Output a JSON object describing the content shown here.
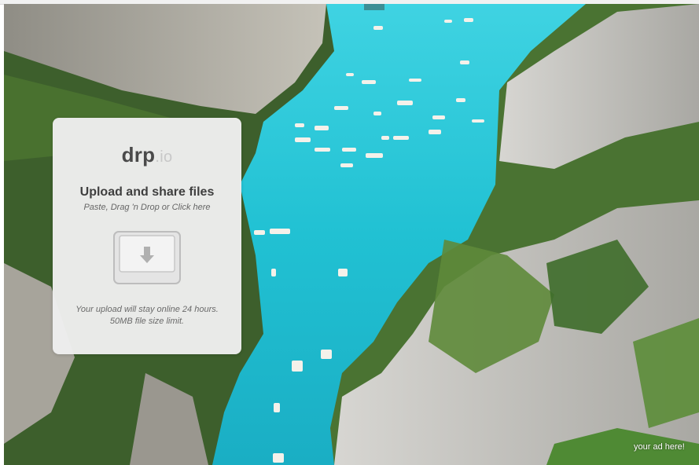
{
  "brand": {
    "name": "drp",
    "tld": ".io"
  },
  "card": {
    "title": "Upload and share files",
    "subtitle": "Paste, Drag 'n Drop or Click here",
    "note_line1": "Your upload will stay online 24 hours.",
    "note_line2": "50MB file size limit."
  },
  "ad": {
    "label": "your ad here!"
  },
  "icons": {
    "upload": "upload-tray-download-arrow-icon"
  },
  "colors": {
    "water": "#2fc3d6",
    "cliff": "#b9b8b2",
    "vegetation": "#3f6b2c",
    "card_bg": "#eeeeee"
  }
}
